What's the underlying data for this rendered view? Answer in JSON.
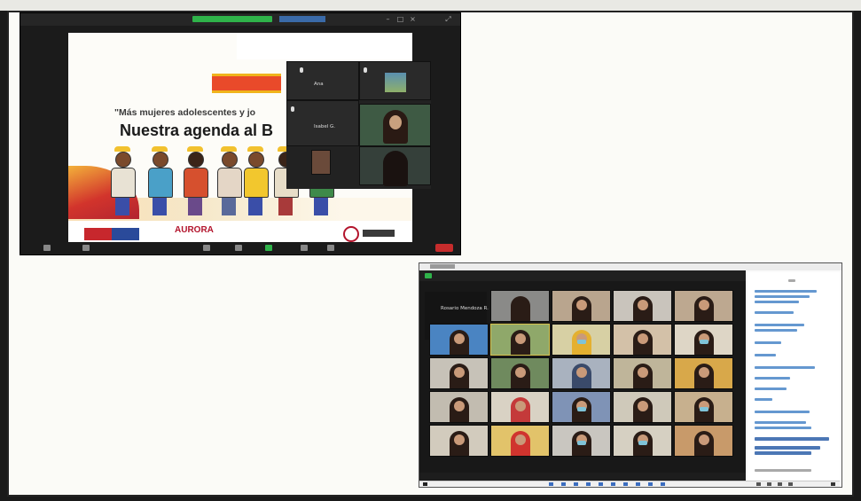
{
  "slide": {
    "subtitle": "\"Más mujeres adolescentes y jo",
    "title": "Nuestra agenda al B",
    "footer_logo": "AURORA"
  },
  "panel": {
    "participants": [
      {
        "name": "Ana"
      },
      {
        "name": ""
      },
      {
        "name": "Isabel G."
      }
    ]
  },
  "gallery": {
    "self_name": "Rosario Mendoza R."
  },
  "colors": {
    "zoom_dark": "#1b1b1b",
    "accent_green": "#2fb34a",
    "slide_red": "#e94a2a",
    "slide_yellow": "#f0b41c",
    "chat_link": "#4a86c8"
  }
}
